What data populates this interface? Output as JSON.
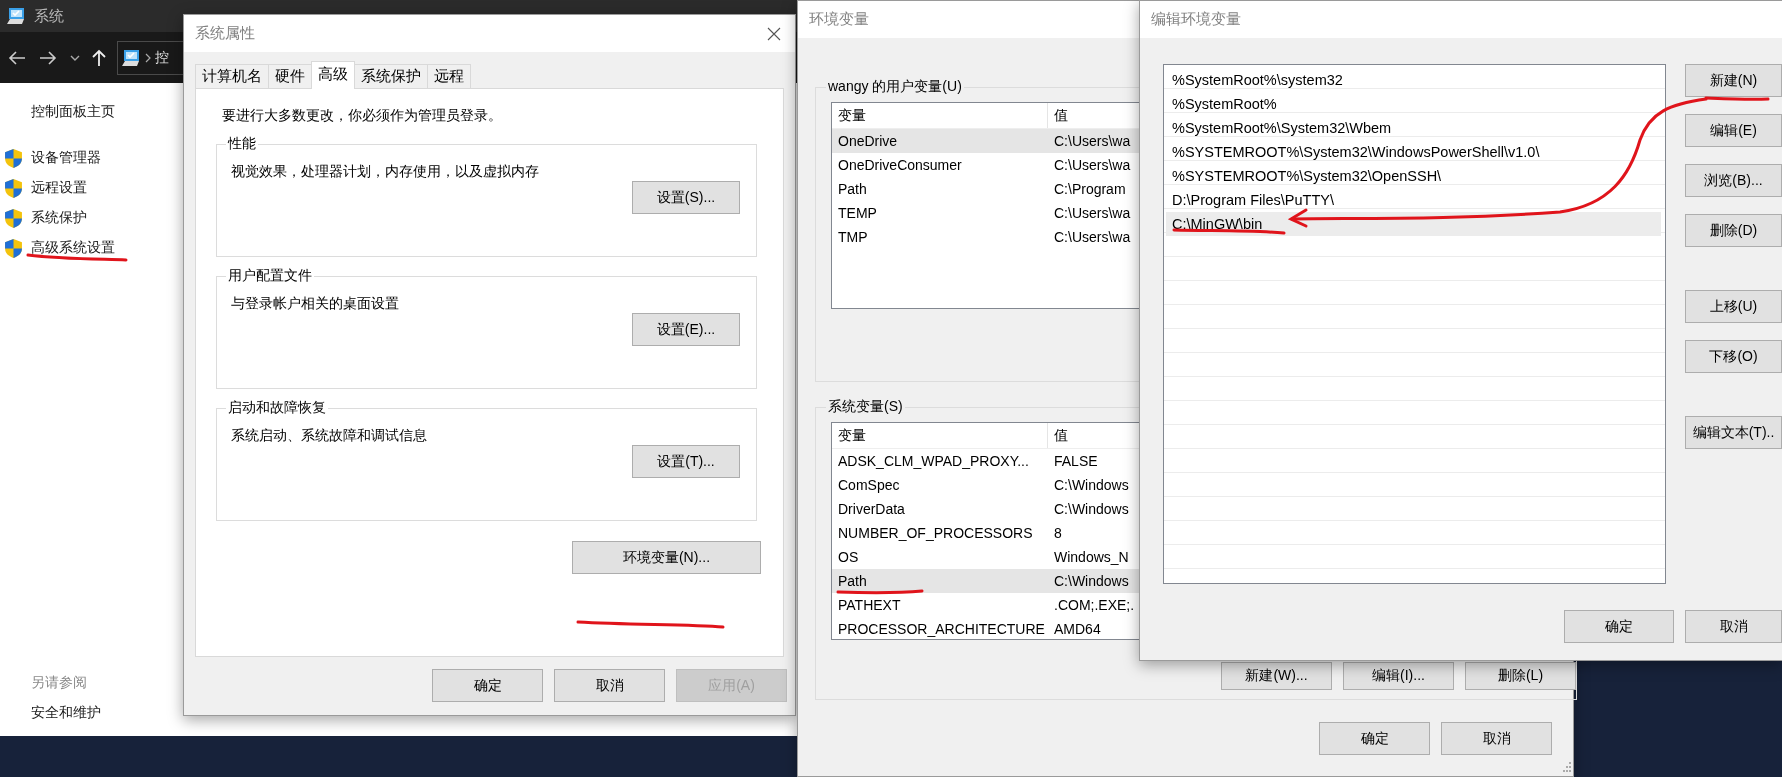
{
  "explorer": {
    "title": "系统",
    "breadcrumb": "控",
    "sidebar": {
      "home": "控制面板主页",
      "items": [
        {
          "label": "设备管理器"
        },
        {
          "label": "远程设置"
        },
        {
          "label": "系统保护"
        },
        {
          "label": "高级系统设置"
        }
      ],
      "see_also_heading": "另请参阅",
      "see_also": [
        {
          "label": "安全和维护"
        }
      ]
    }
  },
  "system_properties": {
    "title": "系统属性",
    "tabs": [
      {
        "label": "计算机名",
        "selected": false
      },
      {
        "label": "硬件",
        "selected": false
      },
      {
        "label": "高级",
        "selected": true
      },
      {
        "label": "系统保护",
        "selected": false
      },
      {
        "label": "远程",
        "selected": false
      }
    ],
    "note": "要进行大多数更改，你必须作为管理员登录。",
    "groups": [
      {
        "title": "性能",
        "description": "视觉效果，处理器计划，内存使用，以及虚拟内存",
        "button": "设置(S)..."
      },
      {
        "title": "用户配置文件",
        "description": "与登录帐户相关的桌面设置",
        "button": "设置(E)..."
      },
      {
        "title": "启动和故障恢复",
        "description": "系统启动、系统故障和调试信息",
        "button": "设置(T)..."
      }
    ],
    "env_button": "环境变量(N)...",
    "buttons": [
      {
        "label": "确定",
        "disabled": false
      },
      {
        "label": "取消",
        "disabled": false
      },
      {
        "label": "应用(A)",
        "disabled": true
      }
    ]
  },
  "env_vars": {
    "title": "环境变量",
    "user_group": {
      "title": "wangy 的用户变量(U)",
      "columns": [
        "变量",
        "值"
      ],
      "rows": [
        {
          "name": "OneDrive",
          "value": "C:\\Users\\wa",
          "selected": true
        },
        {
          "name": "OneDriveConsumer",
          "value": "C:\\Users\\wa",
          "selected": false
        },
        {
          "name": "Path",
          "value": "C:\\Program",
          "selected": false
        },
        {
          "name": "TEMP",
          "value": "C:\\Users\\wa",
          "selected": false
        },
        {
          "name": "TMP",
          "value": "C:\\Users\\wa",
          "selected": false
        }
      ]
    },
    "system_group": {
      "title": "系统变量(S)",
      "columns": [
        "变量",
        "值"
      ],
      "rows": [
        {
          "name": "ADSK_CLM_WPAD_PROXY...",
          "value": "FALSE",
          "selected": false
        },
        {
          "name": "ComSpec",
          "value": "C:\\Windows",
          "selected": false
        },
        {
          "name": "DriverData",
          "value": "C:\\Windows",
          "selected": false
        },
        {
          "name": "NUMBER_OF_PROCESSORS",
          "value": "8",
          "selected": false
        },
        {
          "name": "OS",
          "value": "Windows_N",
          "selected": false
        },
        {
          "name": "Path",
          "value": "C:\\Windows",
          "selected": true
        },
        {
          "name": "PATHEXT",
          "value": ".COM;.EXE;.",
          "selected": false
        },
        {
          "name": "PROCESSOR_ARCHITECTURE",
          "value": "AMD64",
          "selected": false
        }
      ],
      "buttons": [
        "新建(W)...",
        "编辑(I)...",
        "删除(L)"
      ]
    },
    "buttons": [
      "确定",
      "取消"
    ]
  },
  "edit_var": {
    "title": "编辑环境变量",
    "entries": [
      {
        "text": "%SystemRoot%\\system32",
        "selected": false
      },
      {
        "text": "%SystemRoot%",
        "selected": false
      },
      {
        "text": "%SystemRoot%\\System32\\Wbem",
        "selected": false
      },
      {
        "text": "%SYSTEMROOT%\\System32\\WindowsPowerShell\\v1.0\\",
        "selected": false
      },
      {
        "text": "%SYSTEMROOT%\\System32\\OpenSSH\\",
        "selected": false
      },
      {
        "text": "D:\\Program Files\\PuTTY\\",
        "selected": false
      },
      {
        "text": "C:\\MinGW\\bin",
        "selected": true
      }
    ],
    "side_buttons": [
      "新建(N)",
      "编辑(E)",
      "浏览(B)...",
      "删除(D)",
      "上移(U)",
      "下移(O)",
      "编辑文本(T).."
    ],
    "buttons": [
      "确定",
      "取消"
    ]
  }
}
